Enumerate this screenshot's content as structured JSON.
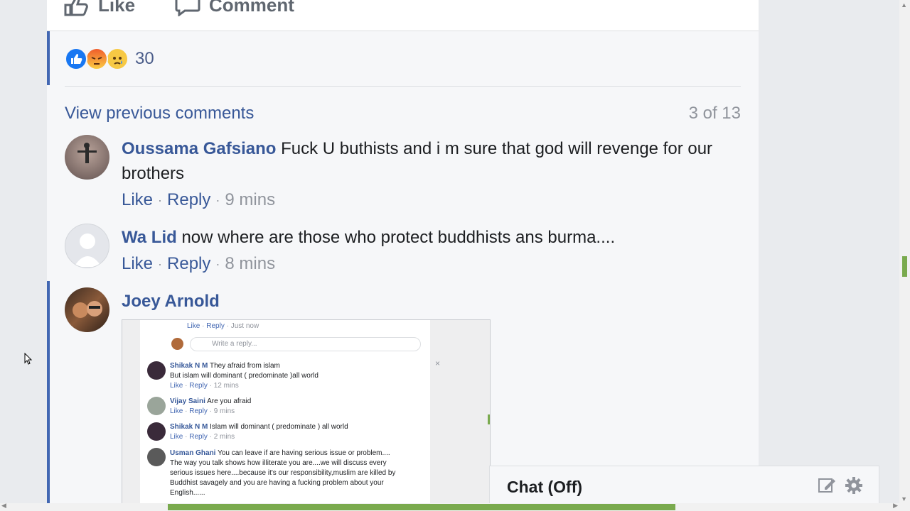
{
  "post_actions": {
    "like_label": "Like",
    "comment_label": "Comment"
  },
  "reactions": {
    "icons": [
      "like-reaction",
      "angry-reaction",
      "sad-reaction"
    ],
    "count": "30"
  },
  "comments_header": {
    "view_previous": "View previous comments",
    "page_count": "3 of 13"
  },
  "comments": [
    {
      "author": "Oussama Gafsiano",
      "text": "Fuck U buthists and i m sure that god will revenge for our brothers",
      "like": "Like",
      "reply": "Reply",
      "time": "9 mins"
    },
    {
      "author": "Wa Lid",
      "text": "now where are those who protect buddhists ans burma....",
      "like": "Like",
      "reply": "Reply",
      "time": "8 mins"
    },
    {
      "author": "Joey Arnold",
      "text": ""
    }
  ],
  "attachment": {
    "top_actions": {
      "like": "Like",
      "reply": "Reply",
      "time": "Just now"
    },
    "reply_placeholder": "Write a reply...",
    "close": "×",
    "comments": [
      {
        "author": "Shikak N M",
        "line1": "They afraid from islam",
        "line2": "But islam will dominant ( predominate )all world",
        "like": "Like",
        "reply": "Reply",
        "time": "12 mins"
      },
      {
        "author": "Vijay Saini",
        "line1": "Are you afraid",
        "like": "Like",
        "reply": "Reply",
        "time": "9 mins"
      },
      {
        "author": "Shikak N M",
        "line1": "Islam will dominant ( predominate ) all world",
        "like": "Like",
        "reply": "Reply",
        "time": "2 mins"
      },
      {
        "author": "Usman Ghani",
        "line1": "You can leave if are having serious issue or problem....",
        "line2": "The way you talk shows how illiterate you are....we will discuss every",
        "line3": "serious issues here....because it's our responsibility,muslim are killed by",
        "line4": "Buddhist savagely and you are having a fucking problem about your",
        "line5": "English......"
      }
    ]
  },
  "chat": {
    "title": "Chat (Off)",
    "icons": [
      "compose-icon",
      "gear-icon"
    ]
  },
  "colors": {
    "link": "#385898",
    "accent": "#4267b2",
    "scroll_thumb": "#7aaa4e"
  }
}
